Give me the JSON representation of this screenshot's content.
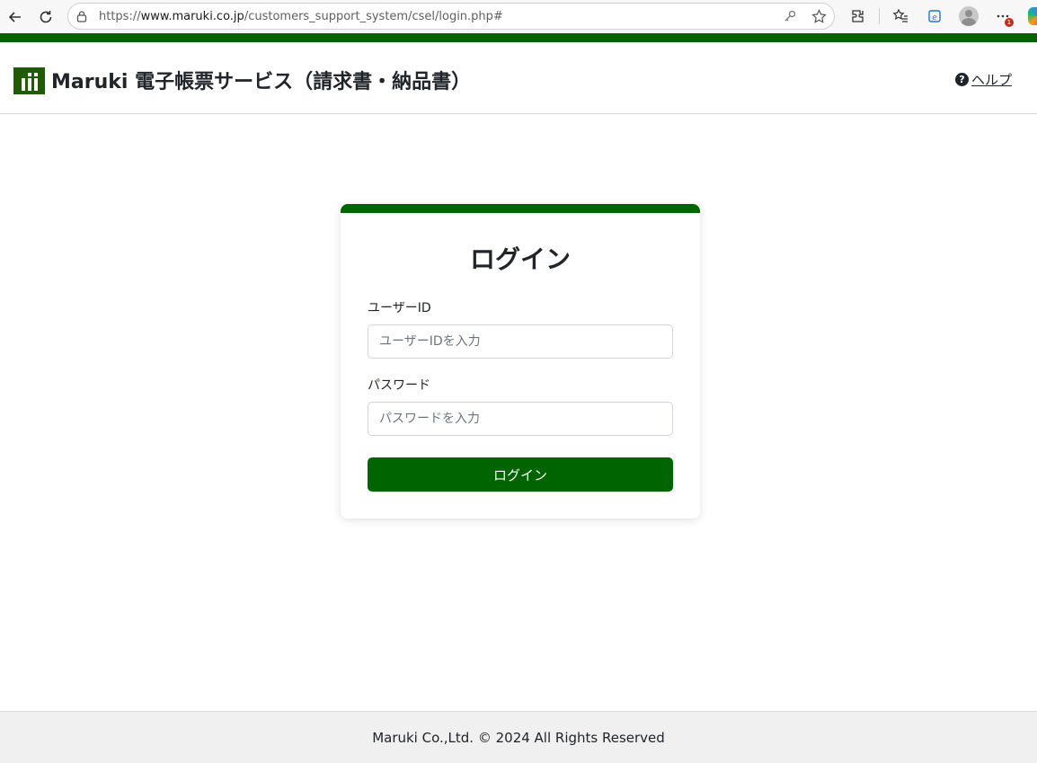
{
  "browser": {
    "url_scheme": "https://",
    "url_host": "www.maruki.co.jp",
    "url_path": "/customers_support_system/csel/login.php#",
    "notification_count": "1"
  },
  "header": {
    "title": "Maruki 電子帳票サービス（請求書・納品書）",
    "help_label": "ヘルプ",
    "help_icon_glyph": "?"
  },
  "login": {
    "title": "ログイン",
    "user_id_label": "ユーザーID",
    "user_id_placeholder": "ユーザーIDを入力",
    "password_label": "パスワード",
    "password_placeholder": "パスワードを入力",
    "submit_label": "ログイン"
  },
  "footer": {
    "copyright": "Maruki Co.,Ltd. © 2024 All Rights Reserved"
  },
  "colors": {
    "brand_green": "#006400",
    "footer_bg": "#f0f0f0"
  }
}
